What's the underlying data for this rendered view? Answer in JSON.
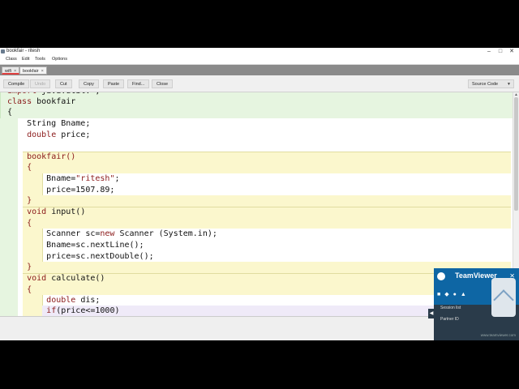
{
  "window": {
    "title": "bookfair - ritesh",
    "minimize": "–",
    "maximize": "□",
    "close": "✕"
  },
  "menu": [
    "Class",
    "Edit",
    "Tools",
    "Options"
  ],
  "tabs": [
    {
      "label": "wifi"
    },
    {
      "label": "bookfair"
    }
  ],
  "toolbar": {
    "compile": "Compile",
    "undo": "Undo",
    "cut": "Cut",
    "copy": "Copy",
    "paste": "Paste",
    "find": "Find...",
    "close": "Close",
    "view_mode": "Source Code"
  },
  "code_lines": [
    "import java.util.*;",
    "class bookfair",
    "{",
    "    String Bname;",
    "    double price;",
    "",
    "    bookfair()",
    "    {",
    "        Bname=\"ritesh\";",
    "        price=1507.89;",
    "    }",
    "    void input()",
    "    {",
    "        Scanner sc=new Scanner (System.in);",
    "        Bname=sc.nextLine();",
    "        price=sc.nextDouble();",
    "    }",
    "    void calculate()",
    "    {",
    "        double dis;",
    "        if(price<=1000)"
  ],
  "teamviewer": {
    "brand": "TeamViewer",
    "session": "Session list",
    "partner": "Partner ID",
    "site": "www.teamviewer.com"
  }
}
